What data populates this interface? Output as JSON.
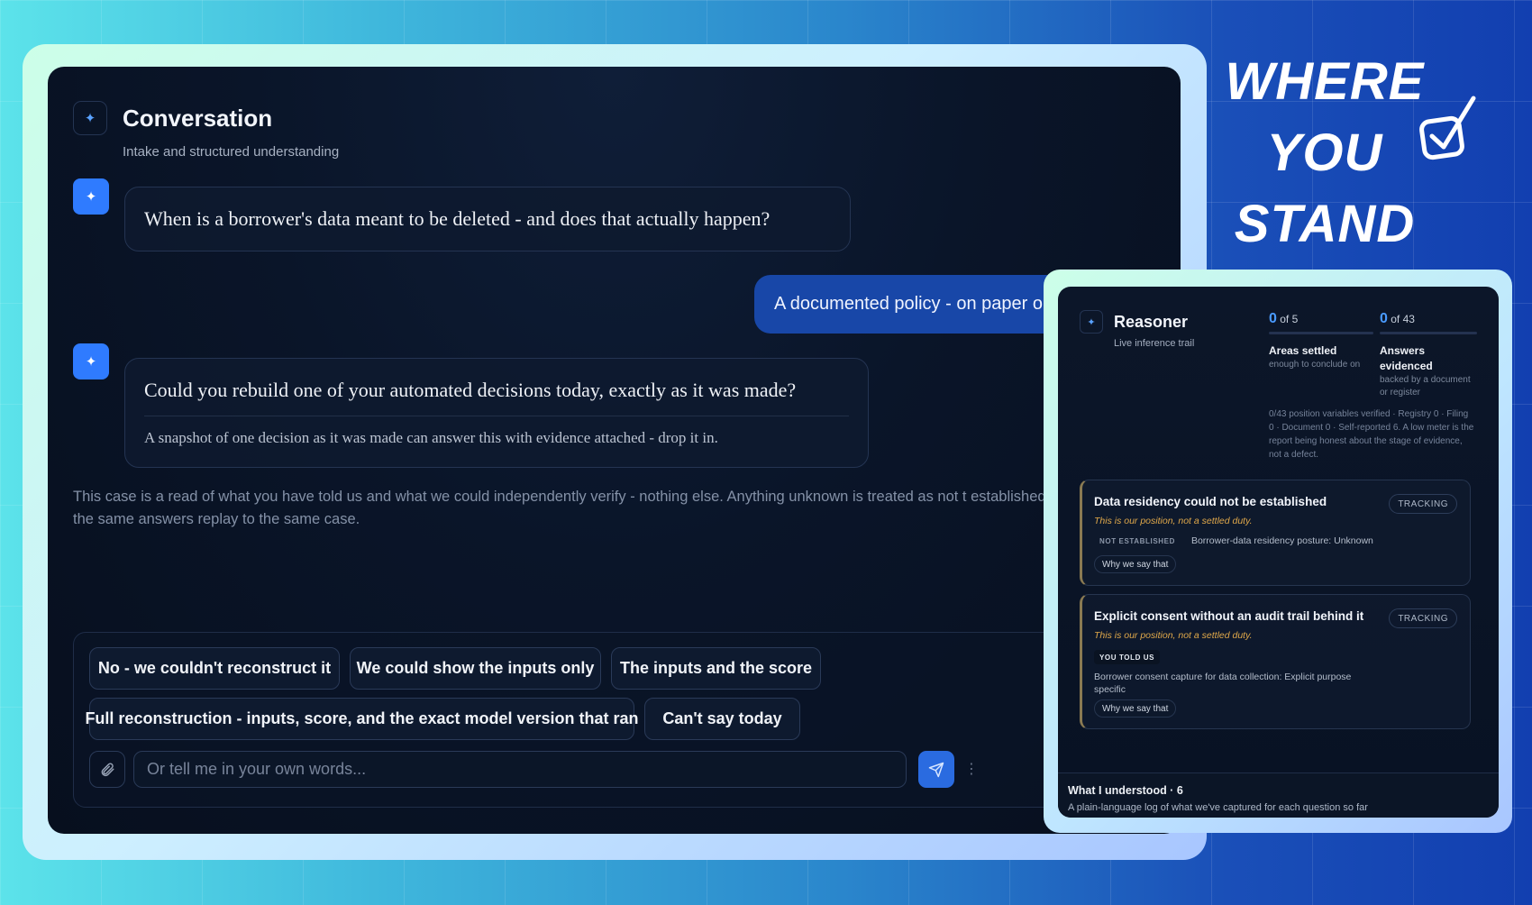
{
  "conversation": {
    "title": "Conversation",
    "subtitle": "Intake and structured understanding",
    "bot_question_1": "When is a borrower's data meant to be deleted - and does that actually happen?",
    "user_answer_1": "A documented policy - on paper only",
    "bot_question_2": "Could you rebuild one of your automated decisions today, exactly as it was made?",
    "bot_hint_2": "A snapshot of one decision as it was made can answer this with evidence attached - drop it in.",
    "disclaimer": "This case is a read of what you have told us and what we could independently verify - nothing else. Anything unknown is treated as not t established, and the same answers replay to the same case.",
    "quick_replies": [
      "No - we couldn't reconstruct it",
      "We could show the inputs only",
      "The inputs and the score",
      "Full reconstruction - inputs, score, and the exact model version that ran",
      "Can't say today"
    ],
    "input_placeholder": "Or tell me in your own words...",
    "icons": {
      "header": "sparkle-icon",
      "bot": "sparkle-icon",
      "attach": "paperclip-icon",
      "send": "send-icon"
    }
  },
  "headline": {
    "line1": "WHERE",
    "line2": "YOU",
    "line3": "STAND",
    "icon": "checkbox-check-icon"
  },
  "reasoner": {
    "title": "Reasoner",
    "subtitle": "Live inference trail",
    "stats": [
      {
        "value": "0",
        "of_text": "of 5",
        "label": "Areas settled",
        "sub": "enough to conclude on",
        "progress": 0
      },
      {
        "value": "0",
        "of_text": "of 43",
        "label": "Answers evidenced",
        "sub": "backed by a document or register",
        "progress": 0
      }
    ],
    "note": "0/43 position variables verified · Registry 0 · Filing 0 · Document 0 · Self-reported 6. A low meter is the report being honest about the stage of evidence, not a defect.",
    "cards": [
      {
        "title": "Data residency could not be established",
        "position": "This is our position, not a settled duty.",
        "status": "TRACKING",
        "tag": "NOT ESTABLISHED",
        "detail": "Borrower-data residency posture: Unknown",
        "why": "Why we say that"
      },
      {
        "title": "Explicit consent without an audit trail behind it",
        "position": "This is our position, not a settled duty.",
        "status": "TRACKING",
        "tag": "YOU TOLD US",
        "detail": "Borrower consent capture for data collection: Explicit purpose specific",
        "why": "Why we say that"
      }
    ],
    "footer_title": "What I understood · 6",
    "footer_sub": "A plain-language log of what we've captured for each question so far"
  },
  "colors": {
    "accent": "#2f7bff",
    "user_bubble": "#1847a8",
    "warning": "#e0a84a",
    "stat_number": "#4a9bff"
  }
}
